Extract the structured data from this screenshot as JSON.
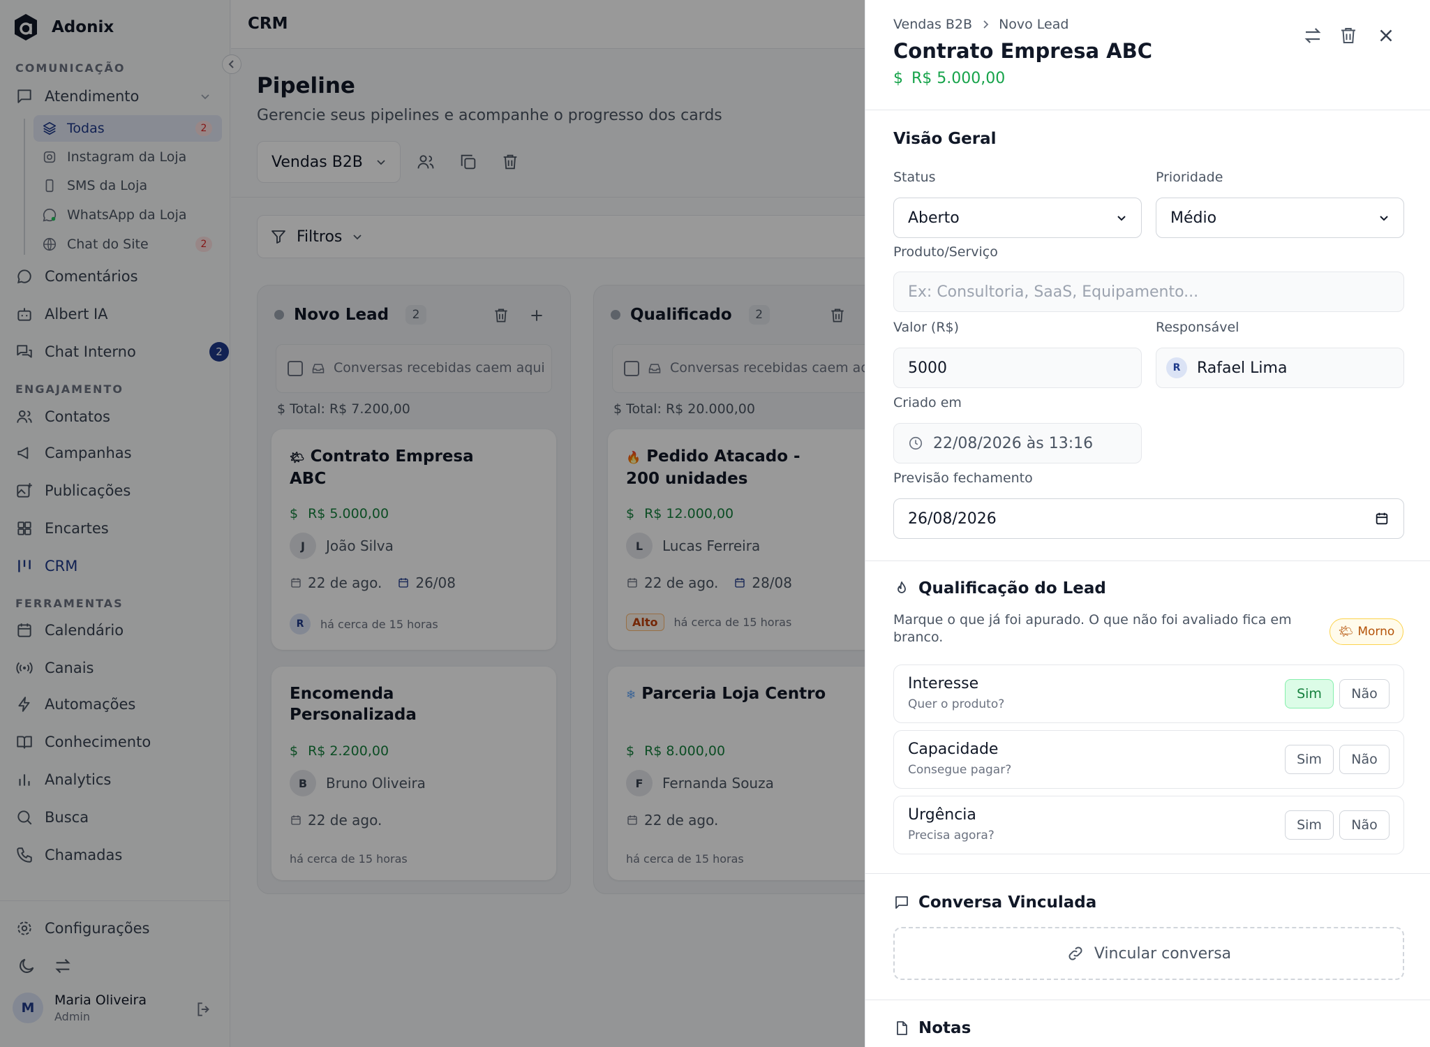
{
  "app": {
    "name": "Adonix"
  },
  "sidebar": {
    "sections": {
      "comunicacao": "COMUNICAÇÃO",
      "engajamento": "ENGAJAMENTO",
      "ferramentas": "FERRAMENTAS"
    },
    "atendimento": "Atendimento",
    "subitems": [
      {
        "label": "Todas",
        "badge": "2"
      },
      {
        "label": "Instagram da Loja"
      },
      {
        "label": "SMS da Loja"
      },
      {
        "label": "WhatsApp da Loja"
      },
      {
        "label": "Chat do Site",
        "badge": "2"
      }
    ],
    "items": {
      "comentarios": "Comentários",
      "albert": "Albert IA",
      "chat_interno": "Chat Interno",
      "chat_interno_badge": "2",
      "contatos": "Contatos",
      "campanhas": "Campanhas",
      "publicacoes": "Publicações",
      "encartes": "Encartes",
      "crm": "CRM",
      "calendario": "Calendário",
      "canais": "Canais",
      "automacoes": "Automações",
      "conhecimento": "Conhecimento",
      "analytics": "Analytics",
      "busca": "Busca",
      "chamadas": "Chamadas",
      "configuracoes": "Configurações"
    },
    "user": {
      "initial": "M",
      "name": "Maria Oliveira",
      "role": "Admin"
    }
  },
  "header": {
    "title": "CRM"
  },
  "pipeline": {
    "title": "Pipeline",
    "subtitle": "Gerencie seus pipelines e acompanhe o progresso dos cards",
    "selected": "Vendas B2B",
    "filters_label": "Filtros"
  },
  "columns": [
    {
      "title": "Novo Lead",
      "count": "2",
      "drop_text": "Conversas recebidas caem aqui",
      "total": "Total: R$ 7.200,00",
      "cards": [
        {
          "emoji": "🌤",
          "title": "Contrato Empresa ABC",
          "value": "R$ 5.000,00",
          "person_initial": "J",
          "person": "João Silva",
          "created": "22 de ago.",
          "due": "26/08",
          "resp_initial": "R",
          "time": "há cerca de 15 horas"
        },
        {
          "title": "Encomenda Personalizada",
          "value": "R$ 2.200,00",
          "person_initial": "B",
          "person": "Bruno Oliveira",
          "created": "22 de ago.",
          "time": "há cerca de 15 horas"
        }
      ]
    },
    {
      "title": "Qualificado",
      "count": "2",
      "drop_text": "Conversas recebidas caem aqui",
      "total": "Total: R$ 20.000,00",
      "cards": [
        {
          "emoji": "🔥",
          "title": "Pedido Atacado - 200 unidades",
          "value": "R$ 12.000,00",
          "person_initial": "L",
          "person": "Lucas Ferreira",
          "created": "22 de ago.",
          "due": "28/08",
          "priority": "Alto",
          "time": "há cerca de 15 horas"
        },
        {
          "emoji": "❄",
          "title": "Parceria Loja Centro",
          "value": "R$ 8.000,00",
          "person_initial": "F",
          "person": "Fernanda Souza",
          "created": "22 de ago.",
          "time": "há cerca de 15 horas"
        }
      ]
    }
  ],
  "drawer": {
    "breadcrumb": [
      "Vendas B2B",
      "Novo Lead"
    ],
    "title": "Contrato Empresa ABC",
    "value": "R$ 5.000,00",
    "overview": {
      "heading": "Visão Geral",
      "status_label": "Status",
      "status": "Aberto",
      "priority_label": "Prioridade",
      "priority": "Médio",
      "product_label": "Produto/Serviço",
      "product_placeholder": "Ex: Consultoria, SaaS, Equipamento...",
      "valor_label": "Valor (R$)",
      "valor": "5000",
      "responsavel_label": "Responsável",
      "responsavel_initial": "R",
      "responsavel": "Rafael Lima",
      "criado_label": "Criado em",
      "criado": "22/08/2026 às 13:16",
      "previsao_label": "Previsão fechamento",
      "previsao": "26/08/2026"
    },
    "qualification": {
      "heading": "Qualificação do Lead",
      "description": "Marque o que já foi apurado. O que não foi avaliado fica em branco.",
      "badge": "Morno",
      "yes": "Sim",
      "no": "Não",
      "rows": [
        {
          "name": "Interesse",
          "question": "Quer o produto?",
          "selected": "Sim"
        },
        {
          "name": "Capacidade",
          "question": "Consegue pagar?"
        },
        {
          "name": "Urgência",
          "question": "Precisa agora?"
        }
      ]
    },
    "linked": {
      "heading": "Conversa Vinculada",
      "button": "Vincular conversa"
    },
    "notes": {
      "heading": "Notas"
    }
  },
  "colors": {
    "brand": "#1e3a8a",
    "money": "#16a34a",
    "danger": "#dc2626",
    "warm": "#b45309"
  }
}
